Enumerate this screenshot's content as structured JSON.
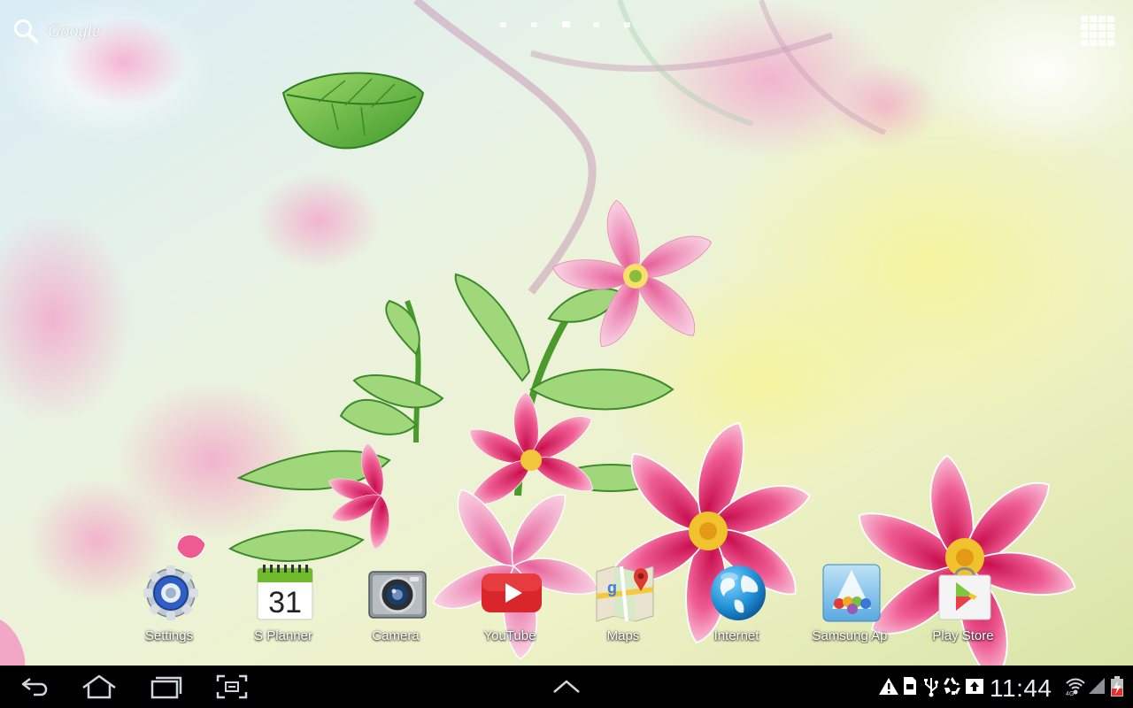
{
  "search_widget": {
    "label": "Google"
  },
  "page_indicator": {
    "count": 5,
    "active_index": 2
  },
  "dock": {
    "apps": [
      {
        "label": "Settings"
      },
      {
        "label": "S Planner",
        "icon_text": "31"
      },
      {
        "label": "Camera"
      },
      {
        "label": "YouTube"
      },
      {
        "label": "Maps"
      },
      {
        "label": "Internet"
      },
      {
        "label": "Samsung Ap"
      },
      {
        "label": "Play Store"
      }
    ]
  },
  "status_bar": {
    "time": "11:44",
    "icons": [
      "warning-icon",
      "sd-card-icon",
      "usb-icon",
      "recycle-icon",
      "upload-icon",
      "wifi-icon",
      "signal-icon",
      "battery-icon"
    ]
  },
  "navigation": {
    "buttons": [
      "back-icon",
      "home-icon",
      "recent-apps-icon",
      "screenshot-icon",
      "up-arrow-icon"
    ]
  },
  "colors": {
    "system_bar": "#000000",
    "clock": "#e9eef2",
    "youtube_red": "#d9262b",
    "battery": "#e3302a"
  }
}
